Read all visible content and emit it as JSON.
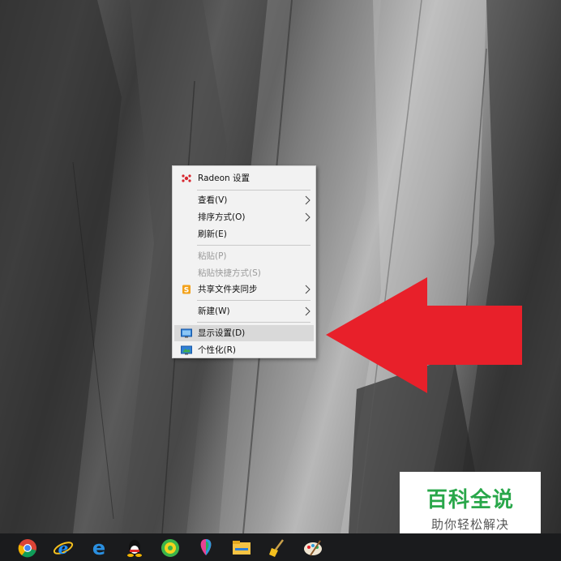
{
  "context_menu": {
    "items": [
      {
        "label": "Radeon 设置",
        "icon": "radeon-icon"
      },
      {
        "label": "查看(V)",
        "submenu": true
      },
      {
        "label": "排序方式(O)",
        "submenu": true
      },
      {
        "label": "刷新(E)"
      },
      {
        "label": "粘贴(P)",
        "disabled": true
      },
      {
        "label": "粘贴快捷方式(S)",
        "disabled": true
      },
      {
        "label": "共享文件夹同步",
        "icon": "share-sync-icon",
        "submenu": true
      },
      {
        "label": "新建(W)",
        "submenu": true
      },
      {
        "label": "显示设置(D)",
        "icon": "display-settings-icon",
        "highlighted": true
      },
      {
        "label": "个性化(R)",
        "icon": "personalize-icon"
      }
    ]
  },
  "watermark": {
    "title": "百科全说",
    "subtitle": "助你轻松解决"
  },
  "taskbar": {
    "icons": [
      "chrome-icon",
      "ie-icon",
      "edge-icon",
      "qq-icon",
      "browser-360-icon",
      "colorful-balloon-icon",
      "file-explorer-icon",
      "cleanup-broom-icon",
      "paint-palette-icon"
    ]
  },
  "colors": {
    "arrow": "#e8202a",
    "watermark_text": "#29a74a",
    "taskbar": "#1a1b1d",
    "menu_bg": "#f2f2f2"
  }
}
